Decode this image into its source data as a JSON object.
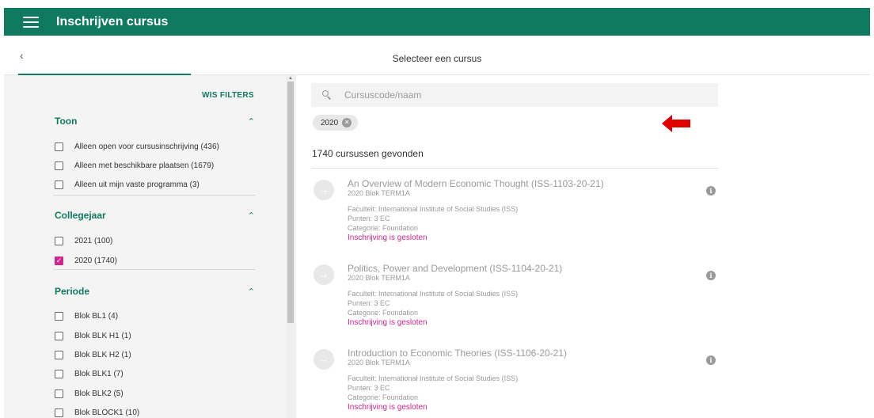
{
  "appbar": {
    "title": "Inschrijven cursus"
  },
  "subheader": {
    "title": "Selecteer een cursus"
  },
  "sidebar": {
    "clear_filters": "WIS FILTERS",
    "sections": [
      {
        "title": "Toon",
        "options": [
          {
            "label": "Alleen open voor cursusinschrijving (436)",
            "checked": false
          },
          {
            "label": "Alleen met beschikbare plaatsen (1679)",
            "checked": false
          },
          {
            "label": "Alleen uit mijn vaste programma (3)",
            "checked": false
          }
        ]
      },
      {
        "title": "Collegejaar",
        "options": [
          {
            "label": "2021 (100)",
            "checked": false
          },
          {
            "label": "2020 (1740)",
            "checked": true
          }
        ]
      },
      {
        "title": "Periode",
        "options": [
          {
            "label": "Blok BL1 (4)",
            "checked": false
          },
          {
            "label": "Blok BLK H1 (1)",
            "checked": false
          },
          {
            "label": "Blok BLK H2 (1)",
            "checked": false
          },
          {
            "label": "Blok BLK1 (7)",
            "checked": false
          },
          {
            "label": "Blok BLK2 (5)",
            "checked": false
          },
          {
            "label": "Blok BLOCK1 (10)",
            "checked": false
          }
        ]
      }
    ]
  },
  "search": {
    "placeholder": "Cursuscode/naam",
    "value": ""
  },
  "active_filter_chip": "2020",
  "results": {
    "count_label": "1740 cursussen gevonden",
    "courses": [
      {
        "title": "An Overview of Modern Economic Thought (ISS-1103-20-21)",
        "block": "2020 Blok TERM1A",
        "faculty": "Faculteit: International Institute of Social Studies (ISS)",
        "points": "Punten: 3 EC",
        "category": "Categorie: Foundation",
        "status": "Inschrijving is gesloten"
      },
      {
        "title": "Politics, Power and Development (ISS-1104-20-21)",
        "block": "2020 Blok TERM1A",
        "faculty": "Faculteit: International Institute of Social Studies (ISS)",
        "points": "Punten: 3 EC",
        "category": "Categorie: Foundation",
        "status": "Inschrijving is gesloten"
      },
      {
        "title": "Introduction to Economic Theories (ISS-1106-20-21)",
        "block": "2020 Blok TERM1A",
        "faculty": "Faculteit: International Institute of Social Studies (ISS)",
        "points": "Punten: 3 EC",
        "category": "Categorie: Foundation",
        "status": "Inschrijving is gesloten"
      }
    ]
  },
  "colors": {
    "brand": "#0f7a5f",
    "accent": "#d0258c",
    "annotation_arrow": "#e00000"
  },
  "icons": {
    "menu": "hamburger-icon",
    "back": "chevron-left-icon",
    "search": "search-icon",
    "collapse": "chevron-up-icon",
    "remove": "close-circle-icon",
    "course": "arrow-right-icon",
    "info": "info-icon"
  }
}
